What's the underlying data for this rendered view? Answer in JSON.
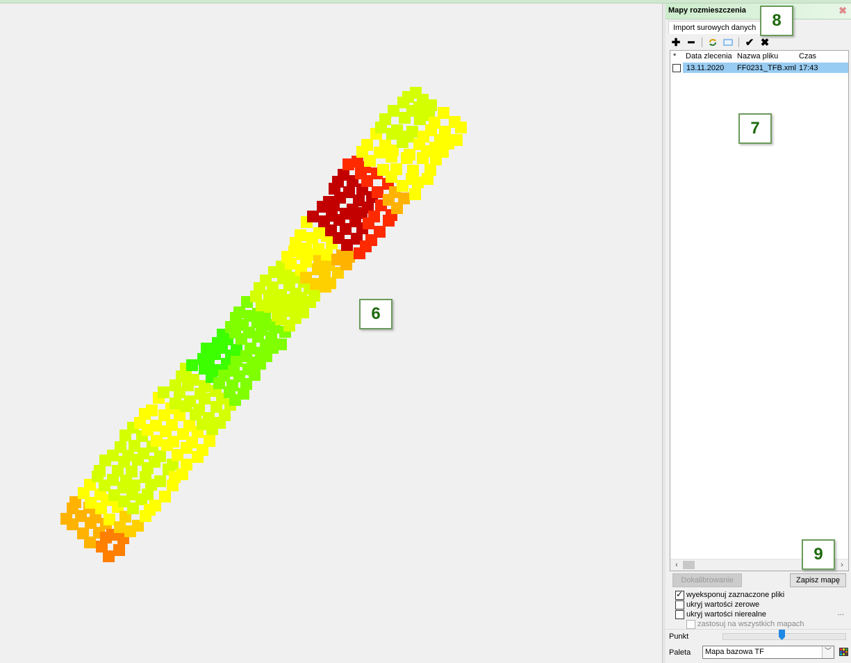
{
  "callouts": {
    "map": "6",
    "list": "7",
    "tab": "8",
    "save": "9"
  },
  "panel": {
    "title": "Mapy rozmieszczenia",
    "tab_label": "Import surowych danych",
    "toolbar": {
      "icons": [
        "plus-icon",
        "minus-icon",
        "refresh-icon",
        "rectangle-icon",
        "checkmark-icon",
        "cross-icon"
      ]
    },
    "list": {
      "columns": {
        "star": "*",
        "date": "Data zlecenia",
        "file": "Nazwa pliku",
        "time": "Czas"
      },
      "rows": [
        {
          "date": "13.11.2020",
          "file": "FF0231_TFB.xml",
          "time": "17:43",
          "selected": true,
          "checked": false
        }
      ]
    },
    "buttons": {
      "calibrate": "Dokalibrowanie",
      "save": "Zapisz mapę"
    },
    "options": {
      "export_selected": "wyeksponuj zaznaczone pliki",
      "hide_zero": "ukryj wartości zerowe",
      "hide_unreal": "ukryj wartości nierealne",
      "apply_all": "zastosuj na wszystkich mapach"
    },
    "ellipsis": "...",
    "point_label": "Punkt",
    "palette_label": "Paleta",
    "palette_value": "Mapa bazowa TF",
    "point_slider_value": 0.49
  },
  "colors": {
    "red_dark": "#c20000",
    "red": "#ff2a00",
    "orange": "#ff7f00",
    "amber": "#ffb300",
    "gold": "#ffd000",
    "yellow": "#ffff00",
    "yellow_green": "#d4ff00",
    "lime": "#b4ff00",
    "green_lime": "#80ff00",
    "green": "#3cff00",
    "selection": "#99ccf2",
    "accent_green": "#1e6a0e"
  }
}
